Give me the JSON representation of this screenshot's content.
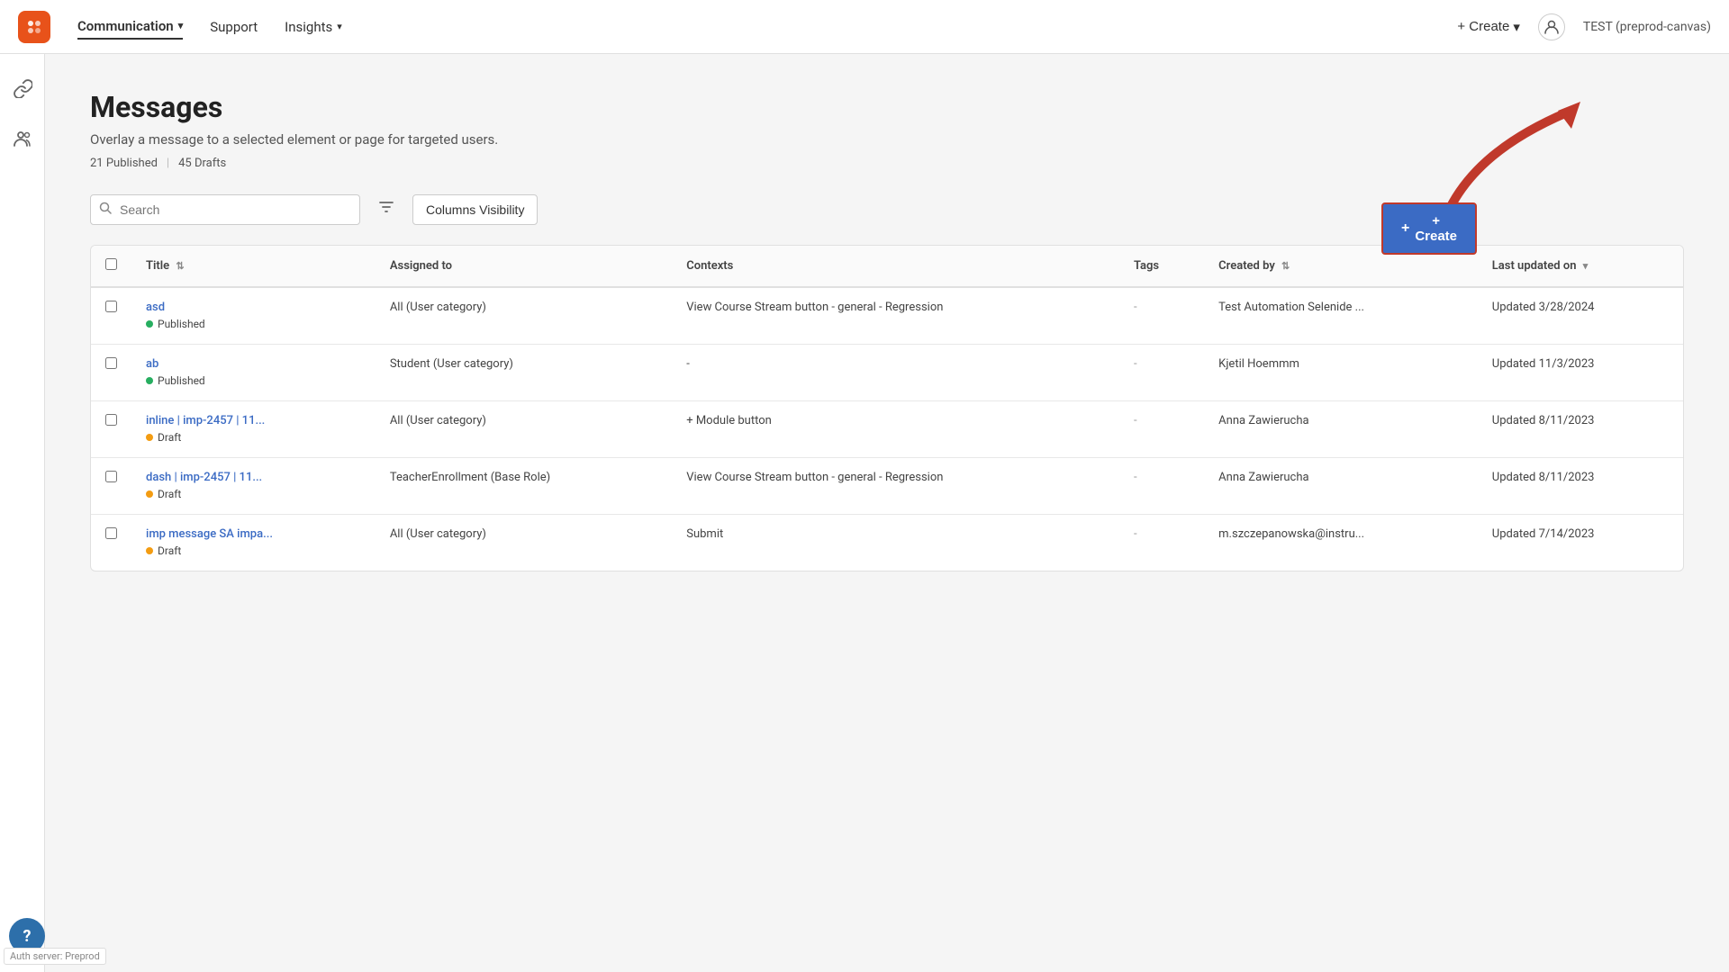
{
  "nav": {
    "logo_symbol": "✦",
    "items": [
      {
        "label": "Communication",
        "active": true,
        "has_dropdown": true
      },
      {
        "label": "Support",
        "active": false,
        "has_dropdown": false
      },
      {
        "label": "Insights",
        "active": false,
        "has_dropdown": true
      }
    ],
    "create_label": "+ Create",
    "env_label": "TEST (preprod-canvas)"
  },
  "sidebar": {
    "icons": [
      {
        "name": "link-icon",
        "symbol": "🔗"
      },
      {
        "name": "people-icon",
        "symbol": "👥"
      }
    ]
  },
  "page": {
    "title": "Messages",
    "subtitle": "Overlay a message to a selected element or page for targeted users.",
    "published_count": "21 Published",
    "drafts_count": "45 Drafts",
    "create_button_label": "+ Create"
  },
  "toolbar": {
    "search_placeholder": "Search",
    "filter_icon": "⊿",
    "columns_visibility_label": "Columns Visibility"
  },
  "table": {
    "columns": [
      {
        "key": "checkbox",
        "label": ""
      },
      {
        "key": "title",
        "label": "Title",
        "sortable": true
      },
      {
        "key": "assigned_to",
        "label": "Assigned to",
        "sortable": false
      },
      {
        "key": "contexts",
        "label": "Contexts",
        "sortable": false
      },
      {
        "key": "tags",
        "label": "Tags",
        "sortable": false
      },
      {
        "key": "created_by",
        "label": "Created by",
        "sortable": true
      },
      {
        "key": "last_updated",
        "label": "Last updated on",
        "sortable": true
      }
    ],
    "rows": [
      {
        "id": 1,
        "title": "asd",
        "status": "Published",
        "status_type": "published",
        "assigned_to": "All (User category)",
        "contexts": "View Course Stream button - general - Regression",
        "tags": "-",
        "created_by": "Test Automation Selenide ...",
        "last_updated": "Updated 3/28/2024"
      },
      {
        "id": 2,
        "title": "ab",
        "status": "Published",
        "status_type": "published",
        "assigned_to": "Student (User category)",
        "contexts": "-",
        "tags": "-",
        "created_by": "Kjetil Hoemmm",
        "last_updated": "Updated 11/3/2023"
      },
      {
        "id": 3,
        "title": "inline | imp-2457 | 11...",
        "status": "Draft",
        "status_type": "draft",
        "assigned_to": "All (User category)",
        "contexts": "+ Module button",
        "tags": "-",
        "created_by": "Anna Zawierucha",
        "last_updated": "Updated 8/11/2023"
      },
      {
        "id": 4,
        "title": "dash | imp-2457 | 11...",
        "status": "Draft",
        "status_type": "draft",
        "assigned_to": "TeacherEnrollment (Base Role)",
        "contexts": "View Course Stream button - general - Regression",
        "tags": "-",
        "created_by": "Anna Zawierucha",
        "last_updated": "Updated 8/11/2023"
      },
      {
        "id": 5,
        "title": "imp message SA impa...",
        "status": "Draft",
        "status_type": "draft",
        "assigned_to": "All (User category)",
        "contexts": "Submit",
        "tags": "-",
        "created_by": "m.szczepanowska@instru...",
        "last_updated": "Updated 7/14/2023"
      }
    ]
  },
  "help": {
    "icon": "?",
    "auth_label": "Auth server: Preprod"
  }
}
